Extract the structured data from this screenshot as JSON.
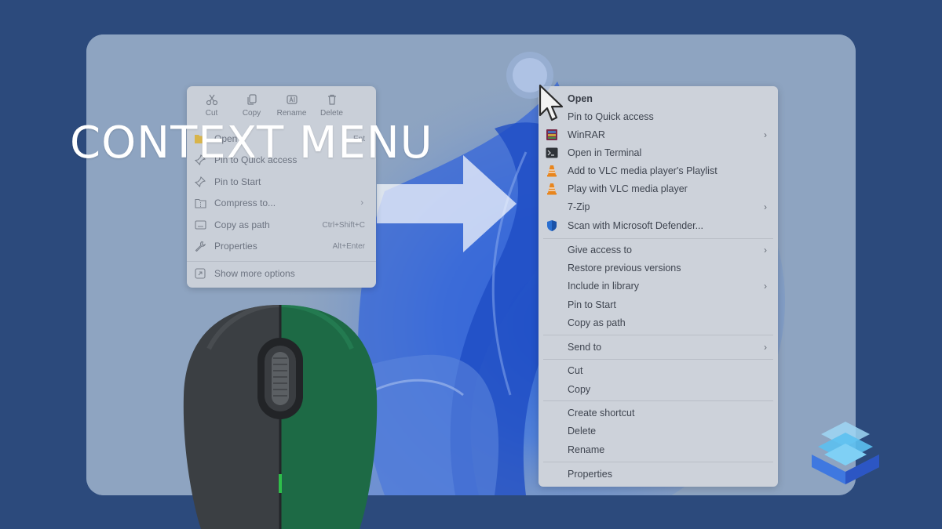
{
  "title": "CONTEXT MENU",
  "small_menu": {
    "toolbar": [
      {
        "label": "Cut",
        "icon": "scissors-icon"
      },
      {
        "label": "Copy",
        "icon": "copy-icon"
      },
      {
        "label": "Rename",
        "icon": "rename-icon"
      },
      {
        "label": "Delete",
        "icon": "trash-icon"
      }
    ],
    "items": [
      {
        "label": "Open",
        "shortcut": "Ent",
        "icon": "folder-icon"
      },
      {
        "label": "Pin to Quick access",
        "icon": "pin-icon"
      },
      {
        "label": "Pin to Start",
        "icon": "pin-icon"
      },
      {
        "label": "Compress to...",
        "icon": "archive-icon",
        "submenu": true
      },
      {
        "label": "Copy as path",
        "shortcut": "Ctrl+Shift+C",
        "icon": "path-icon"
      },
      {
        "label": "Properties",
        "shortcut": "Alt+Enter",
        "icon": "wrench-icon"
      },
      {
        "label": "Show more options",
        "icon": "expand-icon"
      }
    ]
  },
  "large_menu": {
    "items": [
      {
        "label": "Open",
        "bold": true
      },
      {
        "label": "Pin to Quick access"
      },
      {
        "label": "WinRAR",
        "icon": "winrar-icon",
        "submenu": true
      },
      {
        "label": "Open in Terminal",
        "icon": "terminal-icon"
      },
      {
        "label": "Add to VLC media player's Playlist",
        "icon": "vlc-icon"
      },
      {
        "label": "Play with VLC media player",
        "icon": "vlc-icon"
      },
      {
        "label": "7-Zip",
        "submenu": true
      },
      {
        "label": "Scan with Microsoft Defender...",
        "icon": "defender-shield-icon"
      },
      {
        "label": "Give access to",
        "submenu": true
      },
      {
        "label": "Restore previous versions"
      },
      {
        "label": "Include in library",
        "submenu": true
      },
      {
        "label": "Pin to Start"
      },
      {
        "label": "Copy as path"
      },
      {
        "label": "Send to",
        "submenu": true
      },
      {
        "label": "Cut"
      },
      {
        "label": "Copy"
      },
      {
        "label": "Create shortcut"
      },
      {
        "label": "Delete"
      },
      {
        "label": "Rename"
      },
      {
        "label": "Properties"
      }
    ]
  },
  "colors": {
    "background": "#2c4a7c",
    "panel": "#8da3c0",
    "menu": "#cdd2da",
    "mouse_green": "#1d6a45",
    "mouse_dark": "#3b3f43"
  }
}
